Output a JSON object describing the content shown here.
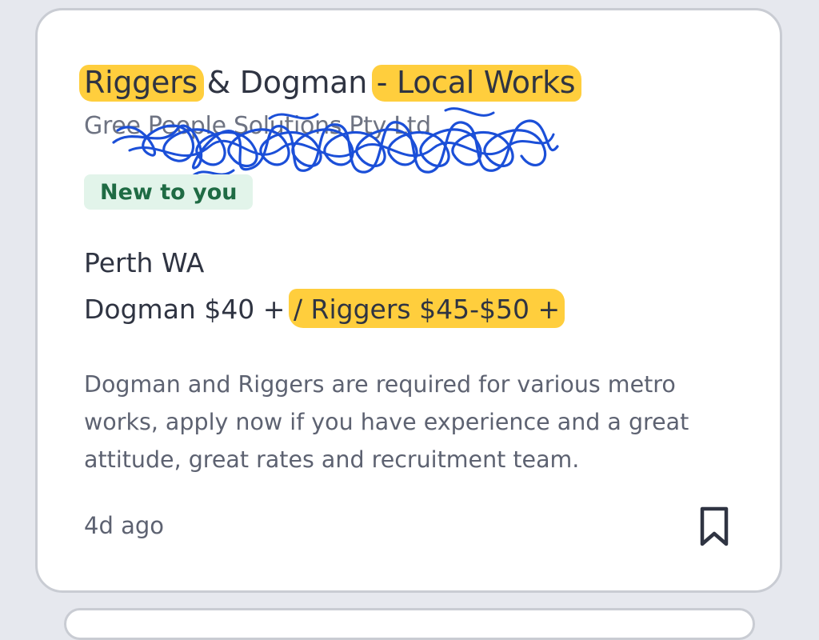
{
  "job": {
    "title_part1": "Riggers",
    "title_part2": " & Dogman ",
    "title_part3": "- Local Works",
    "company": "Gree People Solutions Pty Ltd",
    "badge": "New to you",
    "location": "Perth WA",
    "pay_part1": "Dogman $40 + ",
    "pay_part2": "/ Riggers $45-$50 +",
    "description": "Dogman and Riggers are required for various metro works, apply now if you have experience and a great attitude, great rates and recruitment team.",
    "posted": "4d ago"
  },
  "icons": {
    "bookmark": "bookmark-icon"
  },
  "colors": {
    "highlight": "#ffca2c",
    "scribble": "#1b4fd8",
    "badge_bg": "#e2f4ea",
    "badge_text": "#1f6b44",
    "text_primary": "#2f3442",
    "text_secondary": "#5d6271"
  }
}
